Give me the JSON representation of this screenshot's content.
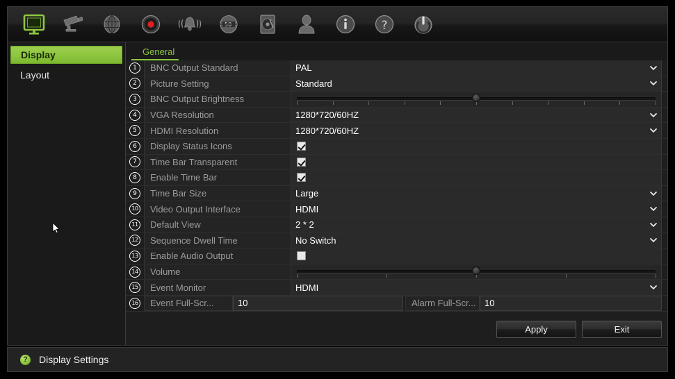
{
  "toolbar": {
    "icons": [
      {
        "name": "monitor-display-icon",
        "label": "Display",
        "active": true
      },
      {
        "name": "camera-icon",
        "label": "Camera",
        "active": false
      },
      {
        "name": "network-icon",
        "label": "Network",
        "active": false
      },
      {
        "name": "record-icon",
        "label": "Record",
        "active": false
      },
      {
        "name": "alarm-bell-icon",
        "label": "Alarm",
        "active": false
      },
      {
        "name": "device-management-icon",
        "label": "Device Management",
        "active": false
      },
      {
        "name": "hdd-icon",
        "label": "HDD",
        "active": false
      },
      {
        "name": "user-icon",
        "label": "User",
        "active": false
      },
      {
        "name": "info-icon",
        "label": "Information",
        "active": false
      },
      {
        "name": "help-icon",
        "label": "Help",
        "active": false
      },
      {
        "name": "power-icon",
        "label": "Shutdown",
        "active": false
      }
    ]
  },
  "sidebar": {
    "items": [
      {
        "label": "Display",
        "active": true
      },
      {
        "label": "Layout",
        "active": false
      }
    ]
  },
  "tabs": [
    {
      "label": "General",
      "active": true
    }
  ],
  "settings": {
    "rows": [
      {
        "num": "1",
        "label": "BNC Output Standard",
        "type": "select",
        "value": "PAL"
      },
      {
        "num": "2",
        "label": "Picture Setting",
        "type": "select",
        "value": "Standard"
      },
      {
        "num": "3",
        "label": "BNC Output Brightness",
        "type": "slider",
        "value": 50,
        "ticks": 10
      },
      {
        "num": "4",
        "label": "VGA Resolution",
        "type": "select",
        "value": "1280*720/60HZ"
      },
      {
        "num": "5",
        "label": "HDMI Resolution",
        "type": "select",
        "value": "1280*720/60HZ"
      },
      {
        "num": "6",
        "label": "Display Status Icons",
        "type": "checkbox",
        "value": true
      },
      {
        "num": "7",
        "label": "Time Bar Transparent",
        "type": "checkbox",
        "value": true
      },
      {
        "num": "8",
        "label": "Enable Time Bar",
        "type": "checkbox",
        "value": true
      },
      {
        "num": "9",
        "label": "Time Bar Size",
        "type": "select",
        "value": "Large"
      },
      {
        "num": "10",
        "label": "Video Output Interface",
        "type": "select",
        "value": "HDMI"
      },
      {
        "num": "11",
        "label": "Default View",
        "type": "select",
        "value": "2 * 2"
      },
      {
        "num": "12",
        "label": "Sequence Dwell Time",
        "type": "select",
        "value": "No Switch"
      },
      {
        "num": "13",
        "label": "Enable Audio Output",
        "type": "checkbox",
        "value": false
      },
      {
        "num": "14",
        "label": "Volume",
        "type": "slider",
        "value": 50,
        "ticks": 4
      },
      {
        "num": "15",
        "label": "Event Monitor",
        "type": "select",
        "value": "HDMI"
      },
      {
        "num": "16",
        "label": "Event Full-Scr...",
        "type": "dual",
        "value": "10",
        "label2": "Alarm Full-Scr...",
        "value2": "10"
      }
    ]
  },
  "buttons": {
    "apply": "Apply",
    "exit": "Exit"
  },
  "statusbar": {
    "icon": "help-circle-icon",
    "glyph": "?",
    "text": "Display Settings"
  },
  "colors": {
    "accent_green": "#8dc63f",
    "panel_bg": "#1e1e1e",
    "row_label_bg": "#242424",
    "row_value_bg": "#2a2a2a",
    "label_text": "#9b9b9b",
    "value_text": "#ffffff"
  }
}
